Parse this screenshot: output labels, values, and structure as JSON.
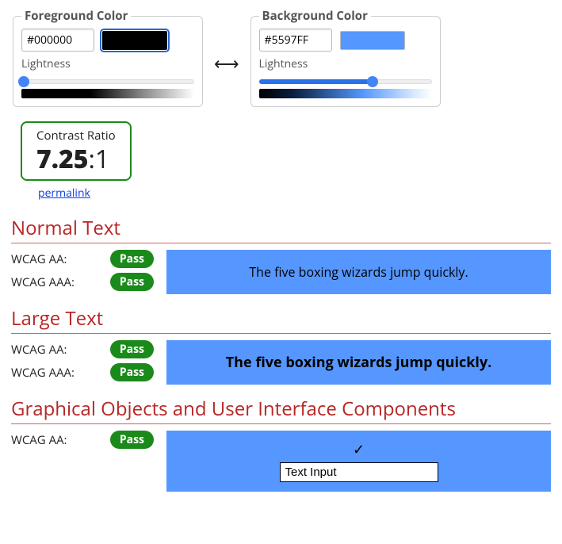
{
  "foreground": {
    "legend": "Foreground Color",
    "hex": "#000000",
    "lightness_label": "Lightness",
    "lightness_pct": 1
  },
  "background": {
    "legend": "Background Color",
    "hex": "#5597FF",
    "lightness_label": "Lightness",
    "lightness_pct": 66
  },
  "swap_symbol": "⟷",
  "ratio": {
    "label": "Contrast Ratio",
    "value": "7.25",
    "suffix": ":1",
    "border_color": "#1a8a1a"
  },
  "permalink_label": "permalink",
  "pass_label": "Pass",
  "sample_text": "The five boxing wizards jump quickly.",
  "ui_input_value": "Text Input",
  "sections": {
    "normal": {
      "title": "Normal Text",
      "aa_label": "WCAG AA:",
      "aa_result": "Pass",
      "aaa_label": "WCAG AAA:",
      "aaa_result": "Pass"
    },
    "large": {
      "title": "Large Text",
      "aa_label": "WCAG AA:",
      "aa_result": "Pass",
      "aaa_label": "WCAG AAA:",
      "aaa_result": "Pass"
    },
    "ui": {
      "title": "Graphical Objects and User Interface Components",
      "aa_label": "WCAG AA:",
      "aa_result": "Pass"
    }
  },
  "colors": {
    "fg": "#000000",
    "bg": "#5597FF",
    "accent_red": "#b82626",
    "pass_green": "#1a8a1a"
  }
}
